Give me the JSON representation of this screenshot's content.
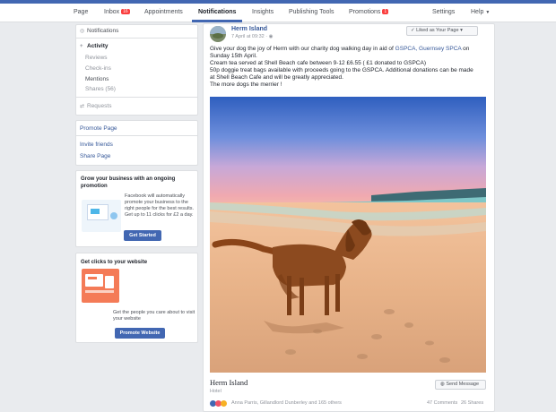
{
  "nav": {
    "page": "Page",
    "inbox": "Inbox",
    "inbox_badge": "16",
    "appointments": "Appointments",
    "notifications": "Notifications",
    "insights": "Insights",
    "publishing_tools": "Publishing Tools",
    "promotions": "Promotions",
    "promotions_badge": "1",
    "settings": "Settings",
    "help": "Help"
  },
  "sidebar": {
    "notifications": "Notifications",
    "activity": "Activity",
    "reviews": "Reviews",
    "checkins": "Check-ins",
    "mentions": "Mentions",
    "shares": "Shares (56)",
    "requests": "Requests",
    "promote_page": "Promote Page",
    "invite_friends": "Invite friends",
    "share_page": "Share Page"
  },
  "promo1": {
    "title": "Grow your business with an ongoing promotion",
    "body": "Facebook will automatically promote your business to the right people for the best results. Get up to 11 clicks for £2 a day.",
    "button": "Get Started"
  },
  "promo2": {
    "title": "Get clicks to your website",
    "body": "Get the people you care about to visit your website",
    "button": "Promote Website"
  },
  "post": {
    "author": "Herm Island",
    "timestamp": "7 April at 09:32",
    "liked_button": "Liked as Your Page",
    "line1a": "Give your dog the joy of Herm with our charity dog walking day in aid of ",
    "line1_link": "GSPCA, Guernsey SPCA",
    "line1b": " on Sunday 15th April.",
    "line2": "Cream tea served at Shell Beach cafe between 9-12 £6.55 ( £1 donated to GSPCA)",
    "line3": "50p doggie treat bags available with proceeds going to the GSPCA. Additional donations can be made at Shell Beach Cafe and will be greatly appreciated.",
    "line4": "The more dogs the merrier !",
    "page_name": "Herm Island",
    "page_category": "Hotel",
    "send_message": "Send Message",
    "reactors": "Anna Parris, Gillandlord Dunberley and 165 others",
    "comments": "47 Comments",
    "shares": "26 Shares"
  },
  "colors": {
    "brand_blue": "#4267b2",
    "link_blue": "#365899",
    "badge_red": "#fa3e3e"
  }
}
